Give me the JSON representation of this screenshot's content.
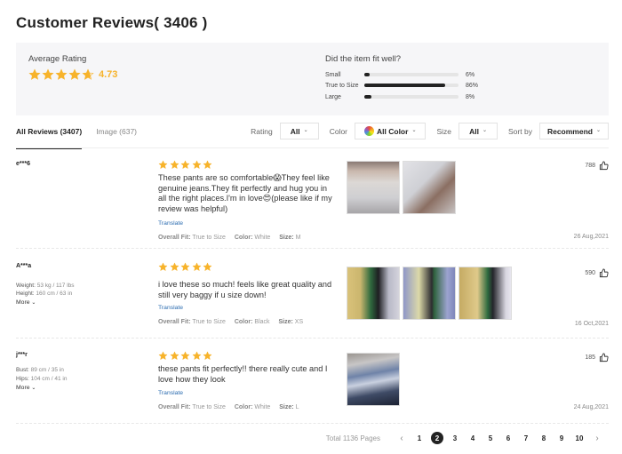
{
  "header": {
    "title": "Customer Reviews( 3406 )"
  },
  "summary": {
    "average_label": "Average Rating",
    "average_value": "4.73",
    "average_rating": 4.73,
    "star_color": "#f7b32b",
    "fit_title": "Did the item fit well?",
    "fit": [
      {
        "label": "Small",
        "percent_text": "6%",
        "percent": 6
      },
      {
        "label": "True to Size",
        "percent_text": "86%",
        "percent": 86
      },
      {
        "label": "Large",
        "percent_text": "8%",
        "percent": 8
      }
    ]
  },
  "tabs": [
    {
      "label": "All Reviews (3407)",
      "active": true
    },
    {
      "label": "Image (637)",
      "active": false
    }
  ],
  "filters": {
    "rating": {
      "label": "Rating",
      "value": "All"
    },
    "color": {
      "label": "Color",
      "value": "All Color",
      "icon": "color-wheel-icon"
    },
    "size": {
      "label": "Size",
      "value": "All"
    },
    "sort": {
      "label": "Sort by",
      "value": "Recommend"
    },
    "chevron": "⌄"
  },
  "reviews": [
    {
      "user": "e***6",
      "measurements": [],
      "more_label": "",
      "rating": 5,
      "text": "These pants are so comfortable😱They feel like genuine jeans.They fit perfectly and hug you in all the right places.I'm in love😍(please like if my review was helpful)",
      "translate": "Translate",
      "meta": {
        "fit_key": "Overall Fit:",
        "fit_val": "True to Size",
        "color_key": "Color:",
        "color_val": "White",
        "size_key": "Size:",
        "size_val": "M"
      },
      "images": [
        "photo-1",
        "photo-2"
      ],
      "likes": "788",
      "date": "26 Aug,2021"
    },
    {
      "user": "A***a",
      "measurements": [
        {
          "key": "Weight:",
          "value": "53 kg / 117 lbs"
        },
        {
          "key": "Height:",
          "value": "160 cm / 63 in"
        }
      ],
      "more_label": "More",
      "rating": 5,
      "text": "i love these so much! feels like great quality and still very baggy if u size down!",
      "translate": "Translate",
      "meta": {
        "fit_key": "Overall Fit:",
        "fit_val": "True to Size",
        "color_key": "Color:",
        "color_val": "Black",
        "size_key": "Size:",
        "size_val": "XS"
      },
      "images": [
        "photo-1",
        "photo-2",
        "photo-3"
      ],
      "likes": "590",
      "date": "16 Oct,2021"
    },
    {
      "user": "j***r",
      "measurements": [
        {
          "key": "Bust:",
          "value": "89 cm / 35 in"
        },
        {
          "key": "Hips:",
          "value": "104 cm / 41 in"
        }
      ],
      "more_label": "More",
      "rating": 5,
      "text": "these pants fit perfectly!! there really cute and I love how they look",
      "translate": "Translate",
      "meta": {
        "fit_key": "Overall Fit:",
        "fit_val": "True to Size",
        "color_key": "Color:",
        "color_val": "White",
        "size_key": "Size:",
        "size_val": "L"
      },
      "images": [
        "photo-1"
      ],
      "likes": "185",
      "date": "24 Aug,2021"
    }
  ],
  "pagination": {
    "total": "Total 1136 Pages",
    "prev": "‹",
    "next": "›",
    "pages": [
      "1",
      "2",
      "3",
      "4",
      "5",
      "6",
      "7",
      "8",
      "9",
      "10"
    ],
    "current": "2"
  }
}
